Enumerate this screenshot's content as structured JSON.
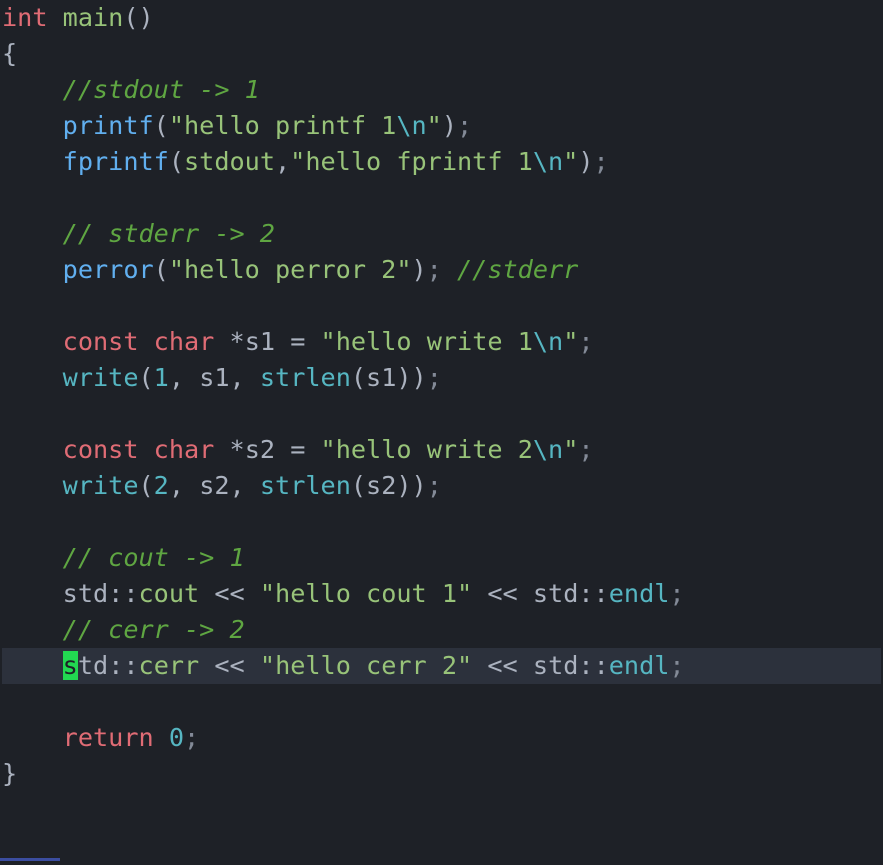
{
  "language": "cpp",
  "theme": "one-dark-like",
  "cursor": {
    "line": 21,
    "col": 5
  },
  "highlighted_line": 21,
  "code": {
    "sig_ret": "int",
    "sig_name": "main",
    "sig_parens": "()",
    "brace_open": "{",
    "indent": "    ",
    "c1": "//stdout -> 1",
    "l_printf_fn": "printf",
    "l_printf_open": "(",
    "l_printf_q1": "\"",
    "l_printf_str": "hello printf 1",
    "l_printf_esc": "\\n",
    "l_printf_q2": "\"",
    "l_printf_close": ")",
    "semi": ";",
    "l_fprintf_fn": "fprintf",
    "l_fprintf_open": "(",
    "l_fprintf_arg": "stdout",
    "l_fprintf_comma": ",",
    "l_fprintf_q1": "\"",
    "l_fprintf_str": "hello fprintf 1",
    "l_fprintf_esc": "\\n",
    "l_fprintf_q2": "\"",
    "l_fprintf_close": ")",
    "c2": "// stderr -> 2",
    "l_perror_fn": "perror",
    "l_perror_open": "(",
    "l_perror_q1": "\"",
    "l_perror_str": "hello perror 2",
    "l_perror_q2": "\"",
    "l_perror_close": ")",
    "l_perror_cmt": "//stderr",
    "decl_const": "const",
    "decl_char": "char",
    "decl_star": "*",
    "s1_name": "s1",
    "eq": "=",
    "s1_q1": "\"",
    "s1_str": "hello write 1",
    "s1_esc": "\\n",
    "s1_q2": "\"",
    "write_fn": "write",
    "num1": "1",
    "num2": "2",
    "comma": ",",
    "sp": " ",
    "strlen_fn": "strlen",
    "s2_name": "s2",
    "s2_q1": "\"",
    "s2_str": "hello write 2",
    "s2_esc": "\\n",
    "s2_q2": "\"",
    "c3": "// cout -> 1",
    "std_ns": "std",
    "coloncolon": "::",
    "cout_id": "cout",
    "cerr_id": "cerr",
    "shl": "<<",
    "cout_q1": "\"",
    "cout_str": "hello cout 1",
    "cout_q2": "\"",
    "endl_id": "endl",
    "c4": "// cerr -> 2",
    "cerr_q1": "\"",
    "cerr_str": "hello cerr 2",
    "cerr_q2": "\"",
    "ret_kw": "return",
    "ret_val": "0",
    "brace_close": "}",
    "cur_letter": "s",
    "cur_rest": "td"
  }
}
